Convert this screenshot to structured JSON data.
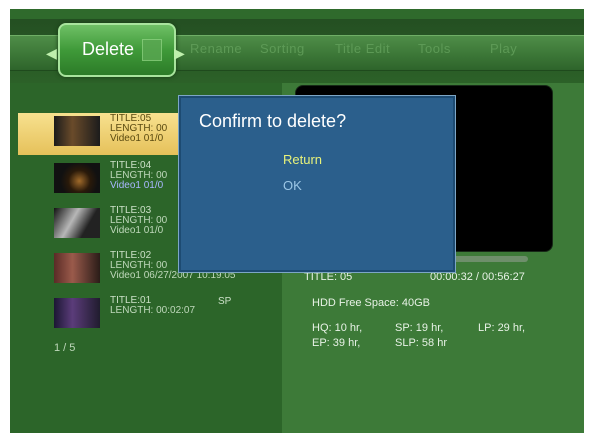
{
  "top_menu": {
    "active_tab": "Delete",
    "items": [
      "Rename",
      "Sorting",
      "Title Edit",
      "Tools",
      "Play"
    ]
  },
  "titles": [
    {
      "title": "TITLE:05",
      "length": "LENGTH: 00",
      "video": "Video1 01/0"
    },
    {
      "title": "TITLE:04",
      "length": "LENGTH: 00",
      "video": "Video1 01/0"
    },
    {
      "title": "TITLE:03",
      "length": "LENGTH: 00",
      "video": "Video1 01/0"
    },
    {
      "title": "TITLE:02",
      "length": "LENGTH: 00",
      "video": "Video1 06/27/2007 10:19:05"
    },
    {
      "title": "TITLE:01",
      "length": "LENGTH: 00:02:07",
      "quality": "SP"
    }
  ],
  "page_counter": "1 / 5",
  "player": {
    "current_title": "TITLE: 05",
    "time": "00:00:32 / 00:56:27"
  },
  "hdd": {
    "free_space": "HDD Free Space: 40GB",
    "modes": {
      "hq": "HQ: 10 hr,",
      "sp": "SP: 19 hr,",
      "lp": "LP: 29 hr,",
      "ep": "EP: 39 hr,",
      "slp": "SLP: 58 hr"
    }
  },
  "dialog": {
    "title": "Confirm to delete?",
    "options": [
      "Return",
      "OK"
    ]
  },
  "colors": {
    "background": "#2f6a2c",
    "selected_row": "#e6c15a",
    "dialog_bg": "#2b5f8c",
    "option_selected": "#e8f27a",
    "option_normal": "#9cc7e6"
  }
}
